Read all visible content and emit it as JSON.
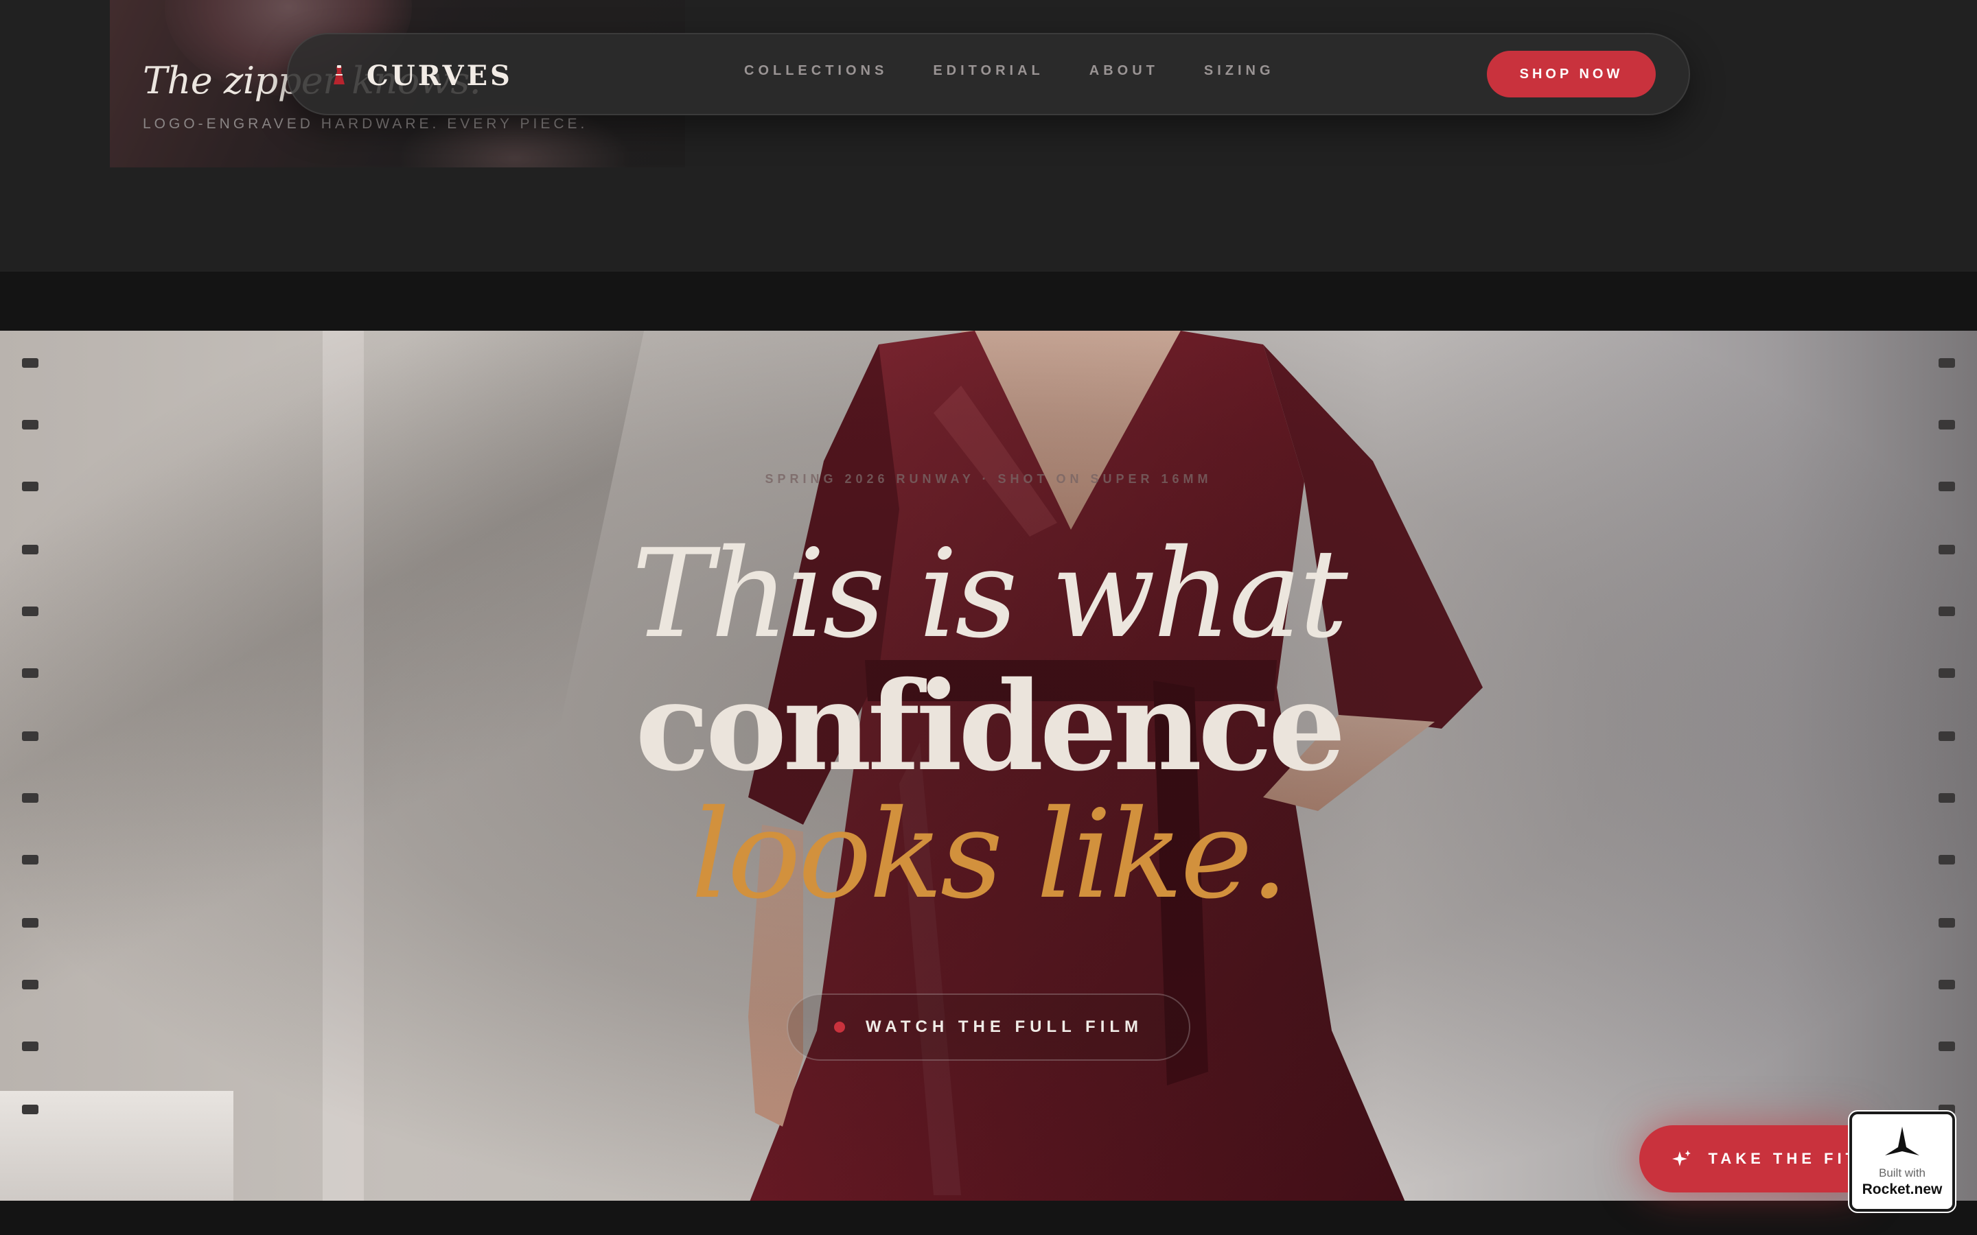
{
  "zipper_card": {
    "title": "The zipper knows.",
    "subtitle": "LOGO-ENGRAVED HARDWARE. EVERY PIECE."
  },
  "nav": {
    "brand": "CURVES",
    "brand_icon": "dress-icon",
    "links": [
      "COLLECTIONS",
      "EDITORIAL",
      "ABOUT",
      "SIZING"
    ],
    "cta": "SHOP NOW"
  },
  "hero": {
    "kicker": "SPRING 2026 RUNWAY · SHOT ON SUPER 16MM",
    "line1": "This is what",
    "line2": "confidence",
    "line3": "looks like.",
    "film_button": "WATCH THE FULL FILM"
  },
  "floating": {
    "fit_button": "TAKE THE FIT",
    "fit_icon": "sparkle-icon",
    "badge_line1": "Built with",
    "badge_line2": "Rocket.new",
    "badge_icon": "rocket-icon"
  },
  "colors": {
    "accent_red": "#c9323d",
    "gold": "#d2913d",
    "dress": "#6e1a26",
    "background": "#212121"
  }
}
